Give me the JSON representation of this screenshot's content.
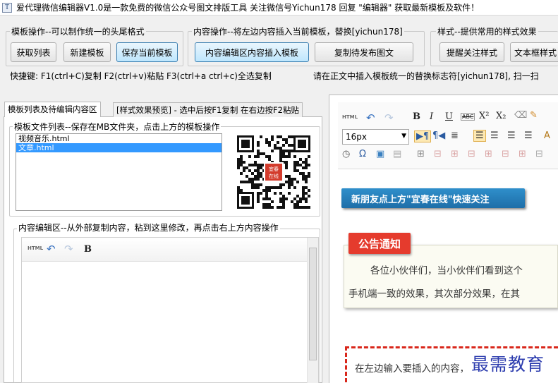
{
  "window": {
    "title": "爱代理微信编辑器V1.0是一款免费的微信公众号图文排版工具 关注微信号Yichun178 回复 \"编辑器\" 获取最新模板及软件！"
  },
  "groups": {
    "template_ops": {
      "label": "模板操作--可以制作统一的头尾格式",
      "buttons": [
        "获取列表",
        "新建模板",
        "保存当前模板"
      ]
    },
    "content_ops": {
      "label": "内容操作--将左边内容插入当前模板，替换[yichun178]",
      "buttons": [
        "内容编辑区内容插入模板",
        "复制待发布图文"
      ]
    },
    "style_ops": {
      "label": "样式--提供常用的样式效果",
      "buttons": [
        "提醒关注样式",
        "文本框样式"
      ]
    }
  },
  "hints": {
    "shortcuts": "快捷键: F1(ctrl+C)复制  F2(ctrl+v)粘贴 F3(ctrl+a ctrl+c)全选复制",
    "placeholder_note": "请在正文中插入模板统一的替换标志符[yichun178],  扫一扫"
  },
  "left_panel": {
    "tabs": [
      "模板列表及待编辑内容区",
      "[样式效果预览] - 选中后按F1复制 在右边按F2粘贴"
    ],
    "file_list_label": "模板文件列表--保存在MB文件夹，点击上方的模板操作",
    "files": [
      "视频音乐.html",
      "文章.html"
    ],
    "selected_file_index": 1,
    "qr_badge": "宜春在线",
    "editor_label": "内容编辑区--从外部复制内容，粘到这里修改，再点击右上方内容操作",
    "mini_toolbar": {
      "html": "HTML",
      "bold": "B"
    }
  },
  "right_panel": {
    "toolbar": {
      "html": "HTML",
      "bold": "B",
      "italic": "I",
      "underline": "U",
      "strike": "ABC",
      "sup": "X²",
      "sub": "X₂",
      "font_size": "16px"
    },
    "banner": "新朋友点上方\"宜春在线\"快速关注",
    "notice_tag": "公告通知",
    "notice_line1": "各位小伙伴们，当小伙伴们看到这个",
    "notice_line2": "手机端一致的效果，其次部分效果，在其",
    "dashed_text": "在左边输入要插入的内容，",
    "watermark": "最需教育"
  },
  "colors": {
    "accent_blue": "#3399ff",
    "banner_blue": "#1e6ea8",
    "notice_red": "#e53b2d",
    "dashed_red": "#d9271b",
    "watermark_blue": "#2c3cae"
  }
}
